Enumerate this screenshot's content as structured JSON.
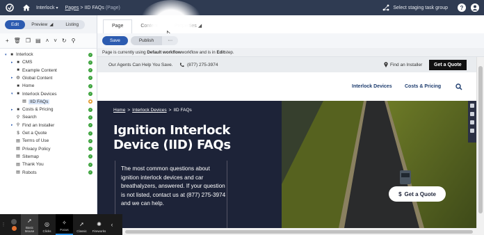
{
  "topbar": {
    "site_name": "Interlock",
    "breadcrumb_pages": "Pages",
    "breadcrumb_page": "IID FAQs",
    "breadcrumb_type": "(Page)",
    "staging_label": "Select staging task group",
    "help_label": "?"
  },
  "modes": {
    "edit": "Edit",
    "preview": "Preview",
    "listing": "Listing"
  },
  "page_tabs": {
    "page": "Page",
    "content": "Content",
    "properties": "Properties"
  },
  "actions": {
    "save": "Save",
    "publish": "Publish",
    "more": "···"
  },
  "notice": {
    "prefix": "Page is currently using ",
    "workflow": "Default workflow",
    "middle": " workflow and is in ",
    "step": "Edit",
    "suffix": " step."
  },
  "tree": [
    {
      "label": "Interlock",
      "icon": "root-page-icon",
      "glyph": "■",
      "status": "green"
    },
    {
      "label": "CMS",
      "icon": "page-icon",
      "glyph": "■",
      "status": "green"
    },
    {
      "label": "Example Content",
      "icon": "page-icon",
      "glyph": "■",
      "status": "green"
    },
    {
      "label": "Global Content",
      "icon": "globe-icon",
      "glyph": "◍",
      "status": "green"
    },
    {
      "label": "Home",
      "icon": "page-icon",
      "glyph": "■",
      "status": "green"
    },
    {
      "label": "Interlock Devices",
      "icon": "page-icon",
      "glyph": "■",
      "status": "green"
    },
    {
      "label": "IID FAQs",
      "icon": "page-icon",
      "glyph": "▤",
      "status": "orange",
      "selected": true
    },
    {
      "label": "Costs & Pricing",
      "icon": "page-icon",
      "glyph": "■",
      "status": "green"
    },
    {
      "label": "Search",
      "icon": "search-icon",
      "glyph": "⚲",
      "status": "green"
    },
    {
      "label": "Find an Installer",
      "icon": "location-pin-icon",
      "glyph": "⚲",
      "status": "green"
    },
    {
      "label": "Get a Quote",
      "icon": "dollar-icon",
      "glyph": "$",
      "status": "green"
    },
    {
      "label": "Terms of Use",
      "icon": "page-icon",
      "glyph": "▤",
      "status": "green"
    },
    {
      "label": "Privacy Policy",
      "icon": "page-icon",
      "glyph": "▤",
      "status": "green"
    },
    {
      "label": "Sitemap",
      "icon": "page-icon",
      "glyph": "▤",
      "status": "green"
    },
    {
      "label": "Thank You",
      "icon": "page-icon",
      "glyph": "▤",
      "status": "green"
    },
    {
      "label": "Robots",
      "icon": "page-icon",
      "glyph": "▤",
      "status": "green"
    }
  ],
  "site": {
    "promo_text": "Our Agents Can Help You Save.",
    "phone": "(877) 275-3974",
    "find_installer": "Find an Installer",
    "quote_button": "Get a Quote",
    "nav_devices": "Interlock Devices",
    "nav_costs": "Costs & Pricing",
    "breadcrumb_home": "Home",
    "breadcrumb_devices": "Interlock Devices",
    "breadcrumb_current": "IID FAQs",
    "hero_title": "Ignition Interlock Device (IID) FAQs",
    "hero_text": "The most common questions about ignition interlock devices and car breathalyzers, answered. If your question is not listed, contact us at (877) 275-3974 and we can help.",
    "hero_cta": "Get a Quote",
    "hero_cta_symbol": "$"
  },
  "clickbar": {
    "modes": [
      {
        "label": "Basic Mouse",
        "icon": "mouse-cursor-icon",
        "state": "selected"
      },
      {
        "label": "Clicks",
        "icon": "click-ripple-icon",
        "state": "normal"
      },
      {
        "label": "Focus",
        "icon": "focus-spotlight-icon",
        "state": "focused"
      },
      {
        "label": "Classic",
        "icon": "classic-cursor-icon",
        "state": "normal"
      },
      {
        "label": "Fireworks",
        "icon": "fireworks-icon",
        "state": "normal"
      }
    ]
  },
  "colors": {
    "topbar": "#2f3b52",
    "accent": "#2c5bb0",
    "nav_text": "#1d3c6e",
    "hero_bg": "#1d2338",
    "status_ok": "#3ca33c",
    "status_pending": "#e39b2e"
  }
}
